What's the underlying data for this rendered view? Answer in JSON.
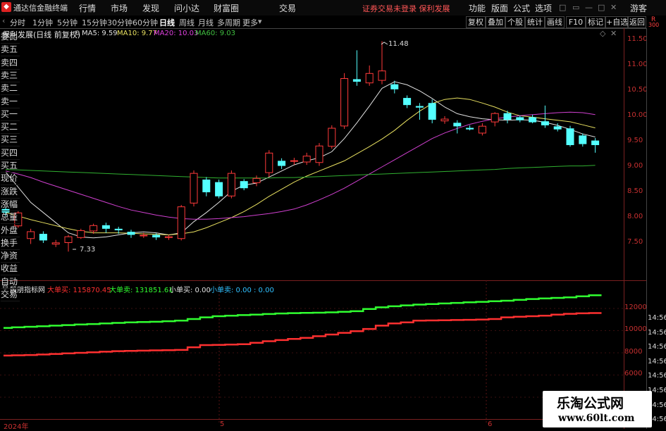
{
  "app": {
    "title": "通达信金融终端",
    "menu": [
      "行情",
      "市场",
      "发现",
      "问小达",
      "财富圈",
      "交易"
    ],
    "alert": "证券交易未登录  保利发展",
    "right_menu": [
      "功能",
      "版面",
      "公式",
      "选项"
    ],
    "user": "游客"
  },
  "toolbar": {
    "periods": [
      "分时",
      "1分钟",
      "5分钟",
      "15分钟",
      "30分钟",
      "60分钟",
      "日线",
      "周线",
      "月线",
      "多周期",
      "更多"
    ],
    "active_period": "日线",
    "buttons": [
      "复权",
      "叠加",
      "个股",
      "统计",
      "画线",
      "F10",
      "标记",
      "+自选",
      "返回"
    ]
  },
  "side_panel": {
    "corner_top": "R",
    "corner_num": "300",
    "items": [
      "委比",
      "卖五",
      "卖四",
      "卖三",
      "卖二",
      "卖一",
      "买一",
      "买二",
      "买三",
      "买四",
      "买五",
      "现价",
      "涨跌",
      "涨幅",
      "总量",
      "外盘",
      "换手",
      "净资",
      "收益",
      "自动",
      "交易"
    ],
    "times": [
      "14:56",
      "14:56",
      "14:56",
      "14:56",
      "14:56",
      "14:56",
      "14:56",
      "14:56"
    ]
  },
  "main_chart": {
    "name": "保利发展(日线 前复权)",
    "legend": [
      {
        "label": "MA5: 9.59",
        "color": "#e0e0e0"
      },
      {
        "label": "MA10: 9.77",
        "color": "#e8e060"
      },
      {
        "label": "MA20: 10.03",
        "color": "#e040e0"
      },
      {
        "label": "MA60: 9.03",
        "color": "#40c040"
      }
    ],
    "y_ticks": [
      "11.50",
      "11.00",
      "10.50",
      "10.00",
      "9.50",
      "9.00",
      "8.50",
      "8.00",
      "7.50"
    ],
    "high_label": "11.48",
    "low_label": "7.33"
  },
  "indicator": {
    "name": "殷朋指标网",
    "legend": [
      {
        "label": "大单买: 115870.45",
        "color": "#ff3030"
      },
      {
        "label": "大单卖: 131851.61",
        "color": "#30ff30"
      },
      {
        "label": "小单买: 0.00",
        "color": "#e0e0e0"
      },
      {
        "label": "小单卖: 0.00 : 0.00",
        "color": "#30c0ff"
      }
    ],
    "y_ticks": [
      "12000",
      "10000",
      "8000",
      "6000",
      "4000"
    ]
  },
  "x_axis": {
    "labels": [
      "2024年",
      "5",
      "6"
    ]
  },
  "watermark": {
    "title": "乐淘公式网",
    "url": "www.60lt.com"
  },
  "chart_data": [
    {
      "type": "candlestick",
      "title": "保利发展(日线 前复权)",
      "ylim": [
        7.2,
        11.8
      ],
      "candles": [
        [
          8.17,
          8.1,
          8.2,
          8.03
        ],
        [
          7.83,
          8.1,
          8.13,
          7.8
        ],
        [
          7.58,
          7.73,
          7.78,
          7.48
        ],
        [
          7.68,
          7.55,
          7.73,
          7.5
        ],
        [
          7.47,
          7.51,
          7.56,
          7.42
        ],
        [
          7.5,
          7.63,
          7.66,
          7.33
        ],
        [
          7.6,
          7.75,
          7.78,
          7.58
        ],
        [
          7.73,
          7.85,
          7.88,
          7.68
        ],
        [
          7.85,
          7.78,
          7.9,
          7.7
        ],
        [
          7.78,
          7.75,
          7.82,
          7.68
        ],
        [
          7.72,
          7.66,
          7.76,
          7.6
        ],
        [
          7.64,
          7.66,
          7.7,
          7.6
        ],
        [
          7.66,
          7.61,
          7.69,
          7.56
        ],
        [
          7.6,
          7.63,
          7.66,
          7.56
        ],
        [
          7.58,
          8.22,
          8.25,
          7.55
        ],
        [
          8.28,
          8.88,
          8.93,
          8.22
        ],
        [
          8.75,
          8.5,
          8.8,
          8.42
        ],
        [
          8.7,
          8.42,
          8.75,
          8.38
        ],
        [
          8.42,
          8.88,
          8.93,
          8.38
        ],
        [
          8.72,
          8.58,
          8.76,
          8.54
        ],
        [
          8.68,
          8.78,
          8.83,
          8.62
        ],
        [
          8.88,
          9.28,
          9.33,
          8.8
        ],
        [
          9.12,
          9.02,
          9.17,
          8.96
        ],
        [
          9.12,
          9.13,
          9.18,
          9.04
        ],
        [
          9.09,
          9.22,
          9.28,
          9.04
        ],
        [
          9.08,
          9.42,
          9.47,
          9.02
        ],
        [
          9.4,
          9.77,
          9.82,
          9.36
        ],
        [
          9.8,
          10.75,
          10.85,
          9.75
        ],
        [
          10.73,
          10.68,
          11.3,
          10.6
        ],
        [
          10.65,
          10.85,
          11.0,
          10.6
        ],
        [
          10.7,
          10.9,
          11.48,
          10.63
        ],
        [
          10.63,
          10.53,
          10.7,
          10.45
        ],
        [
          10.36,
          10.22,
          10.41,
          10.16
        ],
        [
          10.2,
          10.17,
          10.26,
          9.93
        ],
        [
          10.26,
          9.93,
          10.33,
          9.86
        ],
        [
          9.9,
          9.95,
          10.0,
          9.85
        ],
        [
          9.87,
          9.8,
          9.92,
          9.66
        ],
        [
          9.77,
          9.74,
          9.82,
          9.72
        ],
        [
          9.66,
          9.81,
          9.86,
          9.62
        ],
        [
          9.88,
          10.06,
          10.08,
          9.8
        ],
        [
          10.06,
          9.93,
          10.11,
          9.86
        ],
        [
          9.98,
          9.92,
          10.01,
          9.88
        ],
        [
          9.98,
          9.88,
          10.03,
          9.86
        ],
        [
          9.9,
          9.82,
          10.21,
          9.77
        ],
        [
          9.8,
          9.74,
          9.86,
          9.7
        ],
        [
          9.76,
          9.43,
          9.81,
          9.4
        ],
        [
          9.62,
          9.45,
          9.66,
          9.4
        ],
        [
          9.52,
          9.43,
          9.57,
          9.28
        ]
      ],
      "series": [
        {
          "name": "MA5",
          "values": [
            8.9,
            8.6,
            8.3,
            8.1,
            7.9,
            7.7,
            7.62,
            7.6,
            7.62,
            7.66,
            7.7,
            7.72,
            7.7,
            7.66,
            7.7,
            7.92,
            8.1,
            8.3,
            8.52,
            8.64,
            8.68,
            8.8,
            8.92,
            9.04,
            9.12,
            9.18,
            9.3,
            9.56,
            9.87,
            10.2,
            10.55,
            10.68,
            10.62,
            10.5,
            10.35,
            10.18,
            10.05,
            9.99,
            9.95,
            9.93,
            9.92,
            9.93,
            9.92,
            9.88,
            9.82,
            9.74,
            9.65,
            9.59
          ]
        },
        {
          "name": "MA10",
          "values": [
            8.1,
            8.03,
            7.96,
            7.9,
            7.84,
            7.78,
            7.73,
            7.7,
            7.7,
            7.7,
            7.69,
            7.68,
            7.67,
            7.66,
            7.68,
            7.72,
            7.8,
            7.9,
            8.0,
            8.12,
            8.26,
            8.42,
            8.56,
            8.7,
            8.82,
            8.92,
            9.02,
            9.12,
            9.26,
            9.4,
            9.55,
            9.72,
            9.92,
            10.1,
            10.25,
            10.33,
            10.36,
            10.33,
            10.26,
            10.18,
            10.08,
            10.01,
            9.98,
            9.95,
            9.92,
            9.89,
            9.83,
            9.77
          ]
        },
        {
          "name": "MA20",
          "values": [
            8.92,
            8.86,
            8.79,
            8.7,
            8.62,
            8.54,
            8.46,
            8.38,
            8.3,
            8.22,
            8.15,
            8.1,
            8.05,
            8.01,
            7.98,
            7.97,
            7.97,
            7.98,
            8.0,
            8.02,
            8.05,
            8.08,
            8.12,
            8.17,
            8.25,
            8.35,
            8.46,
            8.58,
            8.72,
            8.86,
            9.0,
            9.14,
            9.28,
            9.42,
            9.56,
            9.67,
            9.76,
            9.84,
            9.9,
            9.95,
            9.98,
            10.01,
            10.03,
            10.05,
            10.07,
            10.08,
            10.07,
            10.03
          ]
        },
        {
          "name": "MA60",
          "values": [
            8.95,
            8.94,
            8.93,
            8.92,
            8.91,
            8.9,
            8.89,
            8.88,
            8.87,
            8.86,
            8.85,
            8.84,
            8.83,
            8.82,
            8.81,
            8.8,
            8.79,
            8.78,
            8.78,
            8.78,
            8.78,
            8.78,
            8.79,
            8.79,
            8.8,
            8.81,
            8.82,
            8.83,
            8.84,
            8.85,
            8.86,
            8.87,
            8.88,
            8.89,
            8.9,
            8.91,
            8.92,
            8.93,
            8.94,
            8.95,
            8.97,
            8.98,
            8.99,
            9.0,
            9.01,
            9.02,
            9.02,
            9.03
          ]
        }
      ]
    },
    {
      "type": "line",
      "title": "殷朋指标网",
      "ylim": [
        3000,
        13500
      ],
      "series": [
        {
          "name": "大单买",
          "values": [
            7750,
            7780,
            7800,
            7850,
            7900,
            7950,
            8000,
            8050,
            8100,
            8150,
            8180,
            8200,
            8220,
            8240,
            8260,
            8500,
            8700,
            8720,
            8740,
            8780,
            8900,
            9050,
            9150,
            9250,
            9350,
            9500,
            9650,
            9800,
            9950,
            10150,
            10450,
            10650,
            10750,
            10900,
            10920,
            10940,
            10960,
            10980,
            11000,
            11050,
            11200,
            11250,
            11300,
            11350,
            11450,
            11520,
            11560,
            11587
          ]
        },
        {
          "name": "大单卖",
          "values": [
            10250,
            10300,
            10350,
            10400,
            10450,
            10500,
            10550,
            10600,
            10650,
            10700,
            10750,
            10780,
            10800,
            10850,
            10900,
            11050,
            11200,
            11300,
            11350,
            11400,
            11450,
            11500,
            11550,
            11580,
            11600,
            11620,
            11650,
            11700,
            11750,
            11950,
            12100,
            12200,
            12280,
            12350,
            12400,
            12450,
            12500,
            12550,
            12600,
            12650,
            12700,
            12780,
            12850,
            12900,
            12950,
            13000,
            13100,
            13185
          ]
        }
      ]
    }
  ]
}
